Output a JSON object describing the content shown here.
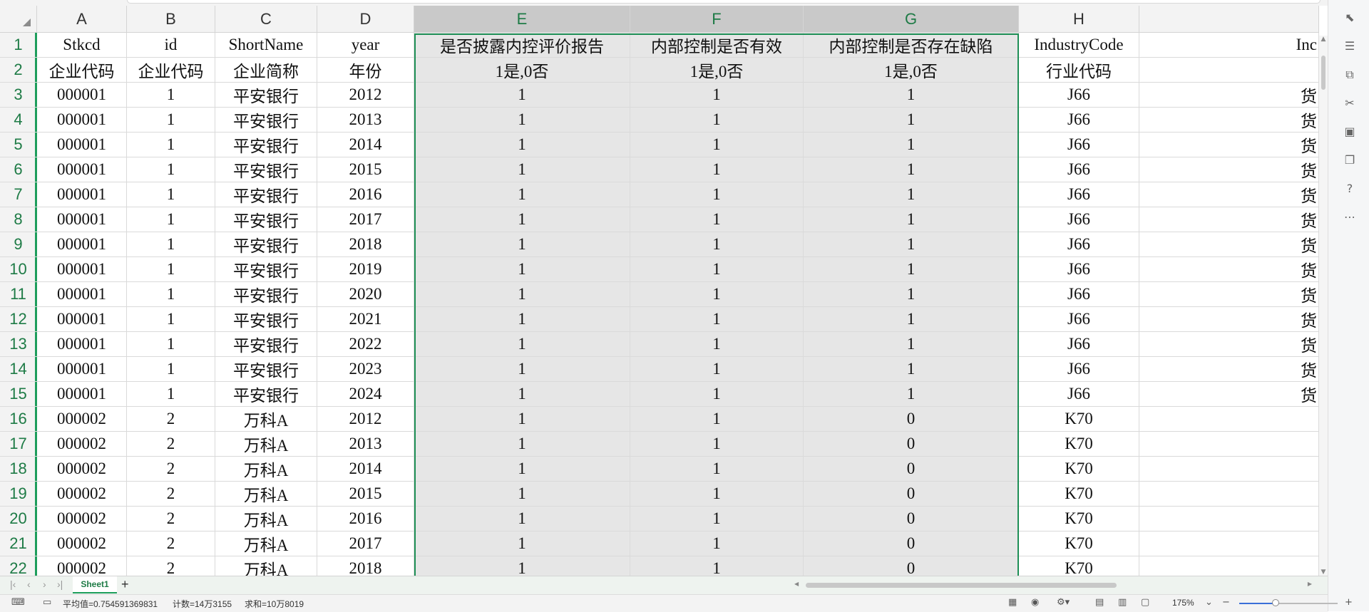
{
  "sheet": {
    "columns": [
      {
        "letter": "A"
      },
      {
        "letter": "B"
      },
      {
        "letter": "C"
      },
      {
        "letter": "D"
      },
      {
        "letter": "E"
      },
      {
        "letter": "F"
      },
      {
        "letter": "G"
      },
      {
        "letter": "H"
      },
      {
        "letter": ""
      }
    ],
    "selected_columns": [
      "E",
      "F",
      "G"
    ],
    "rows": [
      {
        "num": "1",
        "cells": [
          "Stkcd",
          "id",
          "ShortName",
          "year",
          "是否披露内控评价报告",
          "内部控制是否有效",
          "内部控制是否存在缺陷",
          "IndustryCode",
          "Inc"
        ]
      },
      {
        "num": "2",
        "cells": [
          "企业代码",
          "企业代码",
          "企业简称",
          "年份",
          "1是,0否",
          "1是,0否",
          "1是,0否",
          "行业代码",
          ""
        ]
      },
      {
        "num": "3",
        "cells": [
          "000001",
          "1",
          "平安银行",
          "2012",
          "1",
          "1",
          "1",
          "J66",
          "货"
        ]
      },
      {
        "num": "4",
        "cells": [
          "000001",
          "1",
          "平安银行",
          "2013",
          "1",
          "1",
          "1",
          "J66",
          "货"
        ]
      },
      {
        "num": "5",
        "cells": [
          "000001",
          "1",
          "平安银行",
          "2014",
          "1",
          "1",
          "1",
          "J66",
          "货"
        ]
      },
      {
        "num": "6",
        "cells": [
          "000001",
          "1",
          "平安银行",
          "2015",
          "1",
          "1",
          "1",
          "J66",
          "货"
        ]
      },
      {
        "num": "7",
        "cells": [
          "000001",
          "1",
          "平安银行",
          "2016",
          "1",
          "1",
          "1",
          "J66",
          "货"
        ]
      },
      {
        "num": "8",
        "cells": [
          "000001",
          "1",
          "平安银行",
          "2017",
          "1",
          "1",
          "1",
          "J66",
          "货"
        ]
      },
      {
        "num": "9",
        "cells": [
          "000001",
          "1",
          "平安银行",
          "2018",
          "1",
          "1",
          "1",
          "J66",
          "货"
        ]
      },
      {
        "num": "10",
        "cells": [
          "000001",
          "1",
          "平安银行",
          "2019",
          "1",
          "1",
          "1",
          "J66",
          "货"
        ]
      },
      {
        "num": "11",
        "cells": [
          "000001",
          "1",
          "平安银行",
          "2020",
          "1",
          "1",
          "1",
          "J66",
          "货"
        ]
      },
      {
        "num": "12",
        "cells": [
          "000001",
          "1",
          "平安银行",
          "2021",
          "1",
          "1",
          "1",
          "J66",
          "货"
        ]
      },
      {
        "num": "13",
        "cells": [
          "000001",
          "1",
          "平安银行",
          "2022",
          "1",
          "1",
          "1",
          "J66",
          "货"
        ]
      },
      {
        "num": "14",
        "cells": [
          "000001",
          "1",
          "平安银行",
          "2023",
          "1",
          "1",
          "1",
          "J66",
          "货"
        ]
      },
      {
        "num": "15",
        "cells": [
          "000001",
          "1",
          "平安银行",
          "2024",
          "1",
          "1",
          "1",
          "J66",
          "货"
        ]
      },
      {
        "num": "16",
        "cells": [
          "000002",
          "2",
          "万科A",
          "2012",
          "1",
          "1",
          "0",
          "K70",
          ""
        ]
      },
      {
        "num": "17",
        "cells": [
          "000002",
          "2",
          "万科A",
          "2013",
          "1",
          "1",
          "0",
          "K70",
          ""
        ]
      },
      {
        "num": "18",
        "cells": [
          "000002",
          "2",
          "万科A",
          "2014",
          "1",
          "1",
          "0",
          "K70",
          ""
        ]
      },
      {
        "num": "19",
        "cells": [
          "000002",
          "2",
          "万科A",
          "2015",
          "1",
          "1",
          "0",
          "K70",
          ""
        ]
      },
      {
        "num": "20",
        "cells": [
          "000002",
          "2",
          "万科A",
          "2016",
          "1",
          "1",
          "0",
          "K70",
          ""
        ]
      },
      {
        "num": "21",
        "cells": [
          "000002",
          "2",
          "万科A",
          "2017",
          "1",
          "1",
          "0",
          "K70",
          ""
        ]
      },
      {
        "num": "22",
        "cells": [
          "000002",
          "2",
          "万科A",
          "2018",
          "1",
          "1",
          "0",
          "K70",
          ""
        ]
      }
    ]
  },
  "tabs": {
    "sheet_name": "Sheet1",
    "add_label": "+"
  },
  "status": {
    "average": "平均值=0.754591369831",
    "count": "计数=14万3155",
    "sum": "求和=10万8019",
    "zoom": "175%",
    "zoom_level_fraction": 0.37
  },
  "colors": {
    "accent": "#1e9e5c",
    "selected_fill": "#e6e6e6",
    "header_selected": "#c9c9c9"
  },
  "icons": {
    "right_panel": [
      "cursor-icon",
      "sliders-icon",
      "crop-icon",
      "tools-icon",
      "image-edit-icon",
      "book-icon",
      "help-icon",
      "more-icon"
    ]
  }
}
